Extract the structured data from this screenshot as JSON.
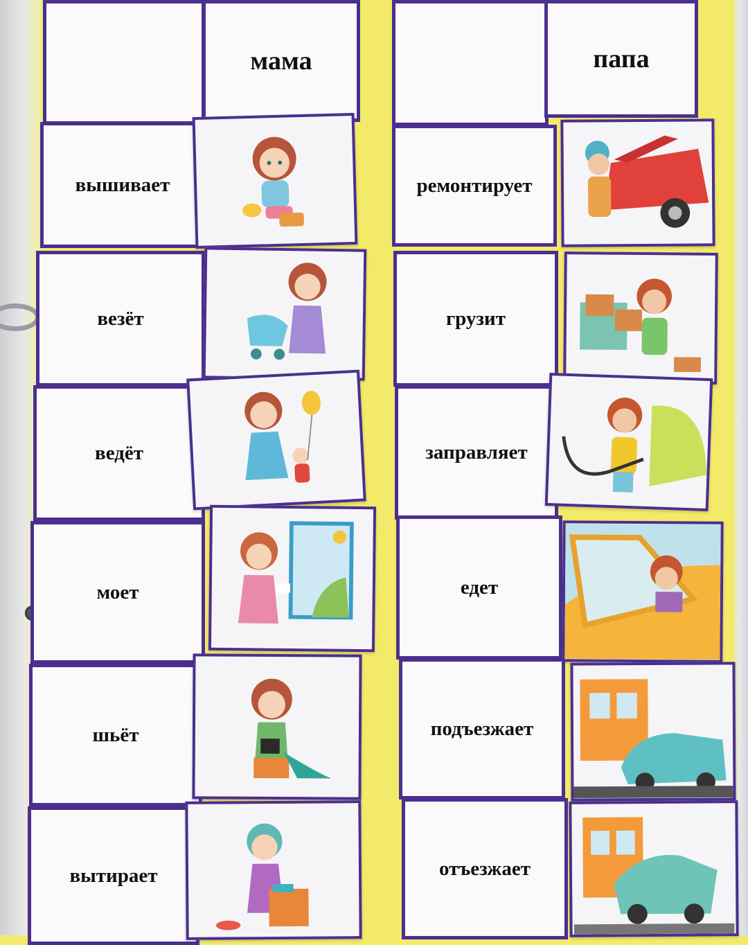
{
  "columns": {
    "left": {
      "header": "мама",
      "verbs": [
        "вышивает",
        "везёт",
        "ведёт",
        "моет",
        "шьёт",
        "вытирает"
      ]
    },
    "right": {
      "header": "папа",
      "verbs": [
        "ремонтирует",
        "грузит",
        "заправляет",
        "едет",
        "подъезжает",
        "отъезжает"
      ]
    }
  },
  "pictures": {
    "left": [
      "mother-embroidering-icon",
      "mother-pushing-stroller-icon",
      "mother-leading-child-icon",
      "mother-washing-window-icon",
      "mother-sewing-machine-icon",
      "mother-wiping-table-icon"
    ],
    "right": [
      "father-repairing-car-icon",
      "father-loading-boxes-icon",
      "father-refueling-car-icon",
      "father-driving-icon",
      "car-arriving-icon",
      "car-leaving-icon"
    ]
  },
  "colors": {
    "board_border": "#4b2f8f",
    "background": "#f3ea6a",
    "card": "#fafafa"
  }
}
